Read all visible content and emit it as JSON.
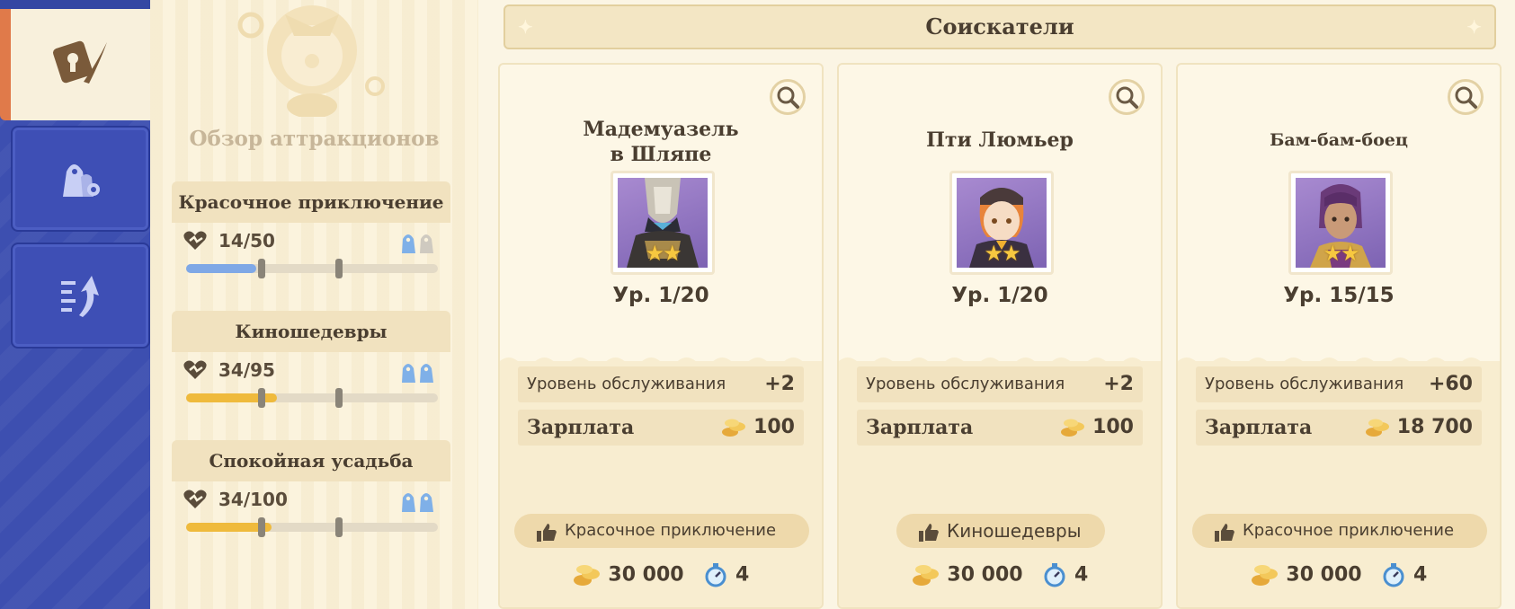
{
  "nav": {
    "tabs": [
      {
        "name": "tab-attraction-overview",
        "icon": "ticket-feather-icon",
        "active": true
      },
      {
        "name": "tab-staff",
        "icon": "staff-gear-icon",
        "active": false
      },
      {
        "name": "tab-upgrade",
        "icon": "upgrade-arrow-icon",
        "active": false
      }
    ]
  },
  "overview": {
    "title": "Обзор аттракционов",
    "attractions": [
      {
        "name": "Красочное приключение",
        "count": "14/50",
        "fill_fraction": 0.28,
        "fill_color": "#7fa8e6",
        "staff_filled": 1,
        "staff_total": 2
      },
      {
        "name": "Киношедевры",
        "count": "34/95",
        "fill_fraction": 0.36,
        "fill_color": "#efba3c",
        "staff_filled": 2,
        "staff_total": 2
      },
      {
        "name": "Спокойная усадьба",
        "count": "34/100",
        "fill_fraction": 0.34,
        "fill_color": "#efba3c",
        "staff_filled": 2,
        "staff_total": 2
      }
    ]
  },
  "applicants": {
    "title": "Соискатели",
    "cards": [
      {
        "name": "Мадемуазель в Шляпе",
        "name_line1": "Мадемуазель",
        "name_line2": "в Шляпе",
        "level": "Ур. 1/20",
        "stars": 2,
        "service_label": "Уровень обслуживания",
        "service_value": "+2",
        "salary_label": "Зарплата",
        "salary_value": "100",
        "preference": "Красочное приключение",
        "cost": "30 000",
        "time": "4",
        "portrait": "armored-knight-portrait"
      },
      {
        "name": "Пти Люмьер",
        "level": "Ур. 1/20",
        "stars": 2,
        "service_label": "Уровень обслуживания",
        "service_value": "+2",
        "salary_label": "Зарплата",
        "salary_value": "100",
        "preference": "Киношедевры",
        "cost": "30 000",
        "time": "4",
        "portrait": "boy-cap-portrait"
      },
      {
        "name": "Бам-бам-боец",
        "level": "Ур. 15/15",
        "stars": 2,
        "service_label": "Уровень обслуживания",
        "service_value": "+60",
        "salary_label": "Зарплата",
        "salary_value": "18 700",
        "preference": "Красочное приключение",
        "cost": "30 000",
        "time": "4",
        "portrait": "braided-girl-portrait"
      }
    ]
  },
  "colors": {
    "accent_orange": "#e07a4a",
    "nav_blue": "#3d4fb0",
    "gold": "#efba3c"
  }
}
